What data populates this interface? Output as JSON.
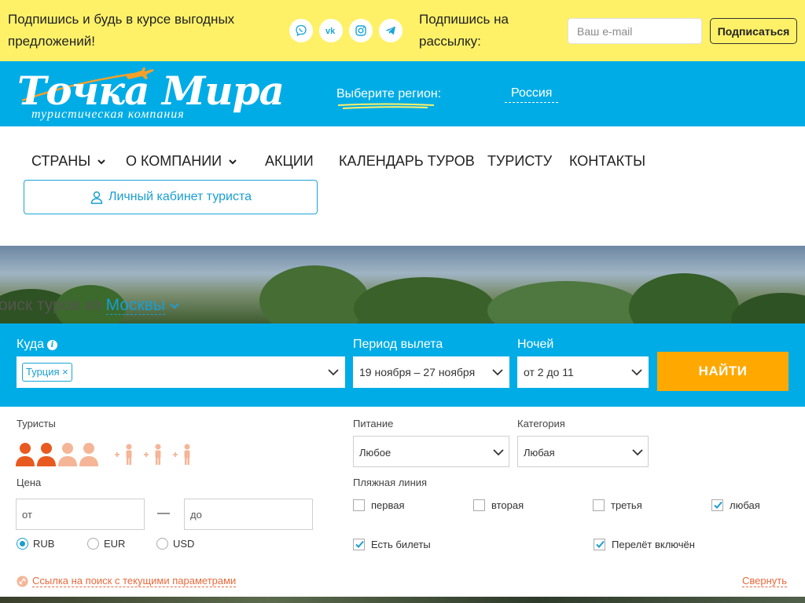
{
  "topbar": {
    "promo_text": "Подпишись и будь в курсе выгодных предложений!",
    "socials": [
      "viber-icon",
      "vk-icon",
      "instagram-icon",
      "telegram-icon"
    ],
    "subscribe_label": "Подпишись на рассылку:",
    "email_placeholder": "Ваш e-mail",
    "subscribe_button": "Подписаться"
  },
  "header": {
    "logo_title": "Точка Мира",
    "logo_subtitle": "туристическая   компания",
    "region_label": "Выберите регион:",
    "region_value": "Россия"
  },
  "nav": {
    "items": [
      {
        "label": "СТРАНЫ",
        "has_dropdown": true
      },
      {
        "label": "О КОМПАНИИ",
        "has_dropdown": true
      },
      {
        "label": "АКЦИИ",
        "has_dropdown": false
      },
      {
        "label": "КАЛЕНДАРЬ ТУРОВ",
        "has_dropdown": false
      },
      {
        "label": "ТУРИСТУ",
        "has_dropdown": false
      },
      {
        "label": "КОНТАКТЫ",
        "has_dropdown": false
      }
    ],
    "cabinet_button": "Личный кабинет туриста"
  },
  "hero": {
    "title_prefix": "оиск туров из ",
    "city": "Москвы"
  },
  "search": {
    "destination_label": "Куда",
    "destination_tag": "Турция",
    "period_label": "Период вылета",
    "period_value": "19 ноября – 27 ноября",
    "nights_label": "Ночей",
    "nights_value": "от 2 до 11",
    "find_button": "НАЙТИ"
  },
  "filters": {
    "tourists_label": "Туристы",
    "adults_selected": 2,
    "adults_total": 4,
    "children_slots": 3,
    "meal_label": "Питание",
    "meal_value": "Любое",
    "category_label": "Категория",
    "category_value": "Любая",
    "price_label": "Цена",
    "price_from_placeholder": "от",
    "price_to_placeholder": "до",
    "price_dash": "—",
    "currencies": [
      {
        "label": "RUB",
        "selected": true
      },
      {
        "label": "EUR",
        "selected": false
      },
      {
        "label": "USD",
        "selected": false
      }
    ],
    "beach_label": "Пляжная линия",
    "beach_options": [
      {
        "label": "первая",
        "checked": false
      },
      {
        "label": "вторая",
        "checked": false
      },
      {
        "label": "третья",
        "checked": false
      },
      {
        "label": "любая",
        "checked": true
      }
    ],
    "tickets_label": "Есть билеты",
    "tickets_checked": true,
    "flight_label": "Перелёт включён",
    "flight_checked": true,
    "search_link": "Ссылка на поиск с текущими параметрами",
    "collapse_link": "Свернуть"
  },
  "colors": {
    "topbar_bg": "#fef168",
    "brand_blue": "#00ace6",
    "accent_orange": "#ffa800",
    "link_orange": "#e86a3c",
    "tourist_selected": "#e85a1f",
    "tourist_unselected": "#f5b597"
  }
}
